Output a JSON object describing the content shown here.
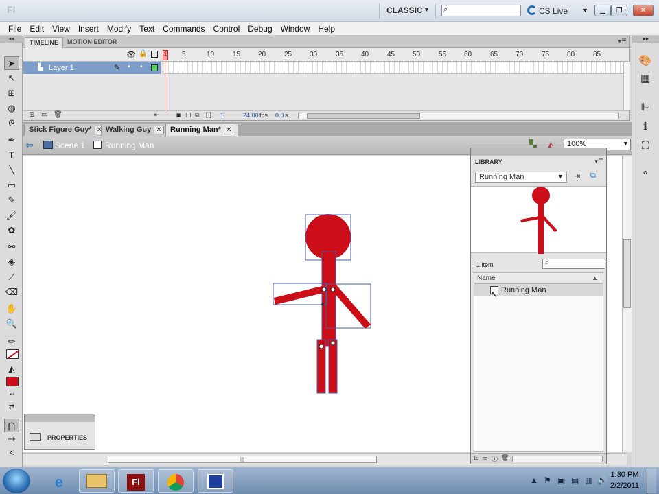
{
  "app": {
    "logo_text": "Fl",
    "workspace": "CLASSIC",
    "cs_live": "CS Live"
  },
  "menu": [
    "File",
    "Edit",
    "View",
    "Insert",
    "Modify",
    "Text",
    "Commands",
    "Control",
    "Debug",
    "Window",
    "Help"
  ],
  "timeline": {
    "tabs": [
      "TIMELINE",
      "MOTION EDITOR"
    ],
    "frame_numbers": [
      "1",
      "5",
      "10",
      "15",
      "20",
      "25",
      "30",
      "35",
      "40",
      "45",
      "50",
      "55",
      "60",
      "65",
      "70",
      "75",
      "80",
      "85"
    ],
    "layer_name": "Layer 1",
    "current_frame": "1",
    "fps": "24.00",
    "fps_unit": "fps",
    "time": "0.0",
    "time_unit": "s"
  },
  "doc_tabs": [
    {
      "label": "Stick Figure Guy*",
      "active": false
    },
    {
      "label": "Walking Guy",
      "active": false
    },
    {
      "label": "Running Man*",
      "active": true
    }
  ],
  "edit_bar": {
    "scene": "Scene 1",
    "symbol": "Running Man",
    "zoom": "100%"
  },
  "library": {
    "title": "LIBRARY",
    "selected_doc": "Running Man",
    "item_count": "1 item",
    "column_name": "Name",
    "items": [
      {
        "label": "Running Man",
        "icon": "movieclip-symbol-icon"
      }
    ]
  },
  "properties": {
    "label": "PROPERTIES"
  },
  "taskbar": {
    "time": "1:30 PM",
    "date": "2/2/2011",
    "apps": [
      "internet-explorer-icon",
      "file-explorer-icon",
      "flash-icon",
      "chrome-icon",
      "app-window-icon"
    ],
    "flash_label": "Fl"
  },
  "colors": {
    "figure_red": "#cc0e18",
    "selection_blue": "#4a5ca8",
    "layer_highlight": "#7d9ec8"
  }
}
